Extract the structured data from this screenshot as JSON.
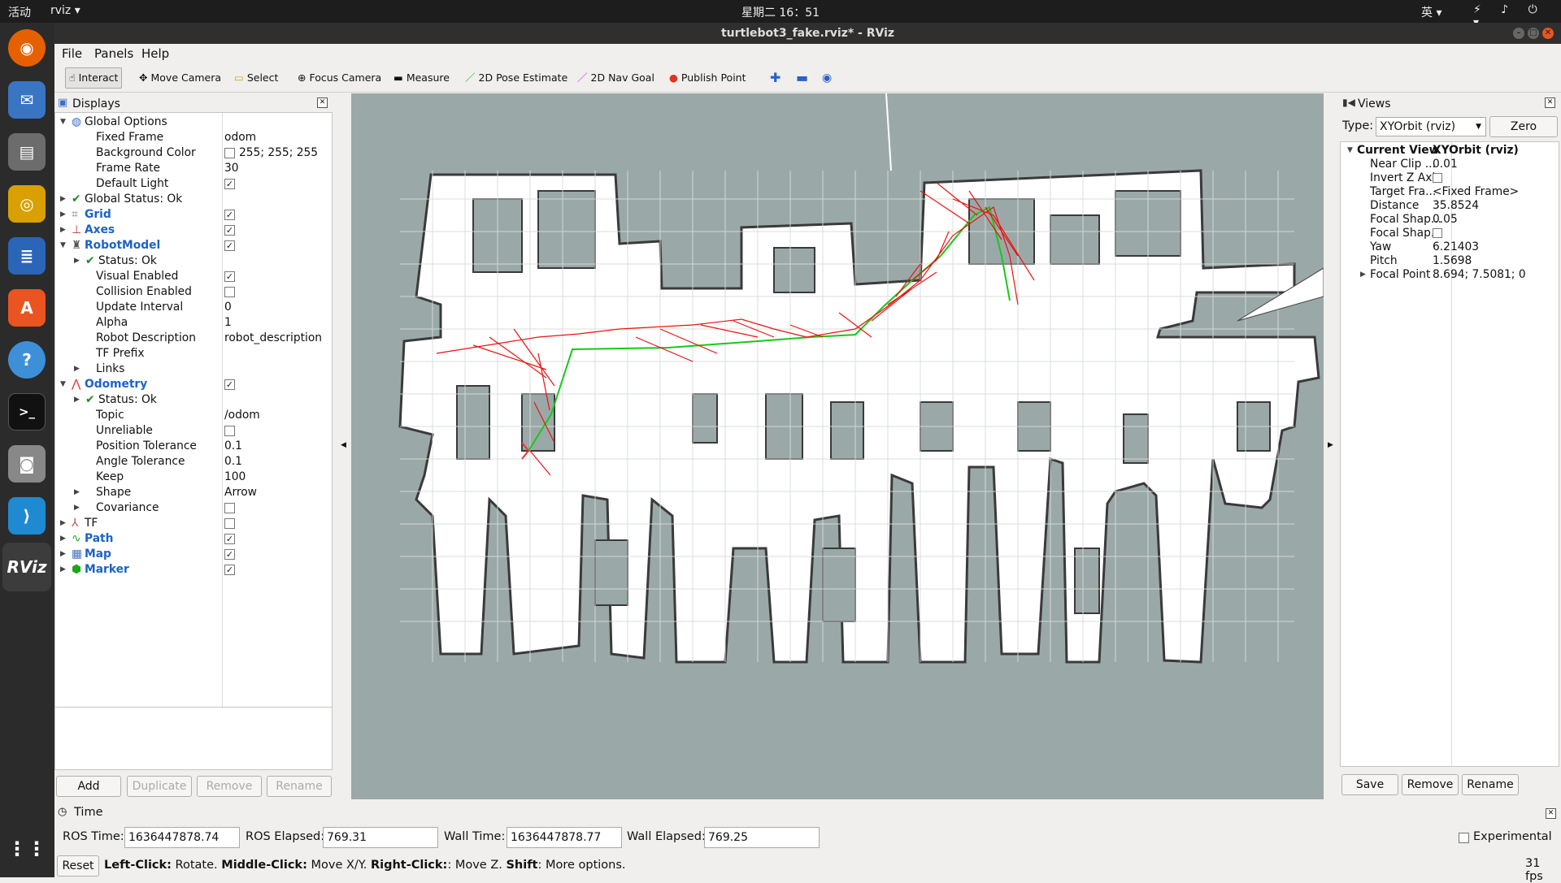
{
  "topbar": {
    "activities": "活动",
    "app": "rviz ▾",
    "clock": "星期二 16：51",
    "ime": "英 ▾",
    "tray": "⚡ ♪ ⏻ ▾"
  },
  "window": {
    "title": "turtlebot3_fake.rviz* - RViz"
  },
  "menu": {
    "file": "File",
    "panels": "Panels",
    "help": "Help"
  },
  "toolbar": {
    "interact": "Interact",
    "move_camera": "Move Camera",
    "select": "Select",
    "focus_camera": "Focus Camera",
    "measure": "Measure",
    "pose_estimate": "2D Pose Estimate",
    "nav_goal": "2D Nav Goal",
    "publish_point": "Publish Point"
  },
  "displays": {
    "title": "Displays",
    "rows": [
      {
        "label": "Global Options",
        "value": ""
      },
      {
        "label": "Fixed Frame",
        "value": "odom"
      },
      {
        "label": "Background Color",
        "value": "255; 255; 255"
      },
      {
        "label": "Frame Rate",
        "value": "30"
      },
      {
        "label": "Default Light",
        "value": ""
      },
      {
        "label": "Global Status: Ok",
        "value": ""
      },
      {
        "label": "Grid",
        "value": ""
      },
      {
        "label": "Axes",
        "value": ""
      },
      {
        "label": "RobotModel",
        "value": ""
      },
      {
        "label": "Status: Ok",
        "value": ""
      },
      {
        "label": "Visual Enabled",
        "value": ""
      },
      {
        "label": "Collision Enabled",
        "value": ""
      },
      {
        "label": "Update Interval",
        "value": "0"
      },
      {
        "label": "Alpha",
        "value": "1"
      },
      {
        "label": "Robot Description",
        "value": "robot_description"
      },
      {
        "label": "TF Prefix",
        "value": ""
      },
      {
        "label": "Links",
        "value": ""
      },
      {
        "label": "Odometry",
        "value": ""
      },
      {
        "label": "Status: Ok",
        "value": ""
      },
      {
        "label": "Topic",
        "value": "/odom"
      },
      {
        "label": "Unreliable",
        "value": ""
      },
      {
        "label": "Position Tolerance",
        "value": "0.1"
      },
      {
        "label": "Angle Tolerance",
        "value": "0.1"
      },
      {
        "label": "Keep",
        "value": "100"
      },
      {
        "label": "Shape",
        "value": "Arrow"
      },
      {
        "label": "Covariance",
        "value": ""
      },
      {
        "label": "TF",
        "value": ""
      },
      {
        "label": "Path",
        "value": ""
      },
      {
        "label": "Map",
        "value": ""
      },
      {
        "label": "Marker",
        "value": ""
      }
    ],
    "buttons": {
      "add": "Add",
      "duplicate": "Duplicate",
      "remove": "Remove",
      "rename": "Rename"
    }
  },
  "views": {
    "title": "Views",
    "type_label": "Type:",
    "type_value": "XYOrbit (rviz)",
    "zero": "Zero",
    "current_view": "Current View",
    "current_value": "XYOrbit (rviz)",
    "props": [
      {
        "label": "Near Clip ...",
        "value": "0.01"
      },
      {
        "label": "Invert Z Axis",
        "value": ""
      },
      {
        "label": "Target Fra...",
        "value": "<Fixed Frame>"
      },
      {
        "label": "Distance",
        "value": "35.8524"
      },
      {
        "label": "Focal Shap...",
        "value": "0.05"
      },
      {
        "label": "Focal Shap...",
        "value": ""
      },
      {
        "label": "Yaw",
        "value": "6.21403"
      },
      {
        "label": "Pitch",
        "value": "1.5698"
      },
      {
        "label": "Focal Point",
        "value": "8.694; 7.5081; 0"
      }
    ],
    "save": "Save",
    "remove": "Remove",
    "rename": "Rename"
  },
  "time": {
    "title": "Time",
    "ros_time_label": "ROS Time:",
    "ros_time": "1636447878.74",
    "ros_elapsed_label": "ROS Elapsed:",
    "ros_elapsed": "769.31",
    "wall_time_label": "Wall Time:",
    "wall_time": "1636447878.77",
    "wall_elapsed_label": "Wall Elapsed:",
    "wall_elapsed": "769.25",
    "experimental": "Experimental"
  },
  "status": {
    "reset": "Reset",
    "h1": "Left-Click:",
    "t1": " Rotate. ",
    "h2": "Middle-Click:",
    "t2": " Move X/Y. ",
    "h3": "Right-Click:",
    "t3": ": Move Z. ",
    "h4": "Shift",
    "t4": ": More options.",
    "fps": "31 fps"
  },
  "colors": {
    "viewport_bg": "#9aa9a8",
    "path": "#18c818",
    "odometry": "#ee1111",
    "accent": "#1c62c8"
  }
}
